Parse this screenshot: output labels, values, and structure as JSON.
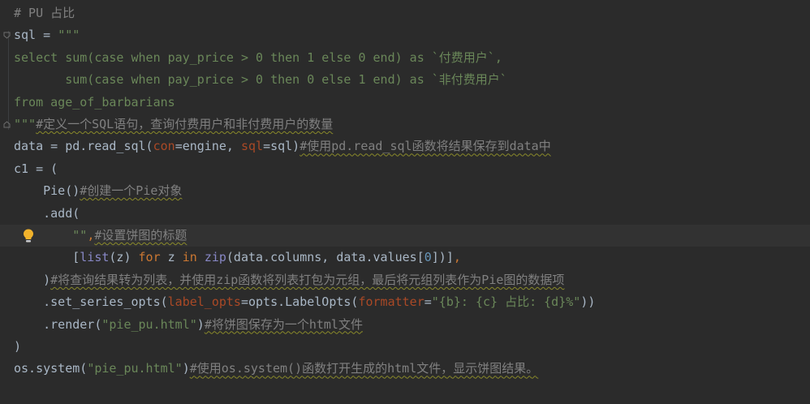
{
  "colors": {
    "background": "#2b2b2b",
    "current_line": "#323232",
    "plain": "#a9b7c6",
    "comment": "#808080",
    "string": "#6a8759",
    "keyword": "#cc7832",
    "builtin": "#8888c6",
    "number": "#6897bb",
    "param": "#aa4926"
  },
  "icons": {
    "fold": "fold-marker-icon",
    "intention": "lightbulb-icon"
  },
  "editor": {
    "lines": [
      {
        "tokens": [
          {
            "c": "t-comment",
            "t": "# PU 占比"
          }
        ]
      },
      {
        "tokens": [
          {
            "c": "t-plain",
            "t": "sql = "
          },
          {
            "c": "t-str",
            "t": "\"\"\""
          }
        ]
      },
      {
        "tokens": [
          {
            "c": "t-str",
            "t": "select sum(case when pay_price > 0 then 1 else 0 end) as `付费用户`,"
          }
        ]
      },
      {
        "tokens": [
          {
            "c": "t-str",
            "t": "       sum(case when pay_price > 0 then 0 else 1 end) as `非付费用户`"
          }
        ]
      },
      {
        "tokens": [
          {
            "c": "t-str",
            "t": "from age_of_barbarians"
          }
        ]
      },
      {
        "tokens": [
          {
            "c": "t-str",
            "t": "\"\"\""
          },
          {
            "c": "t-comment-u",
            "t": "#定义一个SQL语句，查询付费用户和非付费用户的数量"
          }
        ]
      },
      {
        "tokens": [
          {
            "c": "t-plain",
            "t": "data = pd.read_sql("
          },
          {
            "c": "t-param",
            "t": "con"
          },
          {
            "c": "t-plain",
            "t": "=engine, "
          },
          {
            "c": "t-param",
            "t": "sql"
          },
          {
            "c": "t-plain",
            "t": "=sql)"
          },
          {
            "c": "t-comment-u",
            "t": "#使用pd.read_sql函数将结果保存到data中"
          }
        ]
      },
      {
        "tokens": [
          {
            "c": "t-plain",
            "t": "c1 = ("
          }
        ]
      },
      {
        "tokens": [
          {
            "c": "t-plain",
            "t": "    Pie()"
          },
          {
            "c": "t-comment-u",
            "t": "#创建一个Pie对象"
          }
        ]
      },
      {
        "tokens": [
          {
            "c": "t-plain",
            "t": "    .add("
          }
        ]
      },
      {
        "tokens": [
          {
            "c": "t-plain",
            "t": "        "
          },
          {
            "c": "t-str",
            "t": "\"\""
          },
          {
            "c": "t-kw",
            "t": ","
          },
          {
            "c": "t-comment-u",
            "t": "#设置饼图的标题"
          }
        ]
      },
      {
        "tokens": [
          {
            "c": "t-plain",
            "t": "        ["
          },
          {
            "c": "t-builtin",
            "t": "list"
          },
          {
            "c": "t-plain",
            "t": "(z) "
          },
          {
            "c": "t-kw",
            "t": "for"
          },
          {
            "c": "t-plain",
            "t": " z "
          },
          {
            "c": "t-kw",
            "t": "in"
          },
          {
            "c": "t-plain",
            "t": " "
          },
          {
            "c": "t-builtin",
            "t": "zip"
          },
          {
            "c": "t-plain",
            "t": "(data.columns, data.values["
          },
          {
            "c": "t-num",
            "t": "0"
          },
          {
            "c": "t-plain",
            "t": "])]"
          },
          {
            "c": "t-kw",
            "t": ","
          }
        ]
      },
      {
        "tokens": [
          {
            "c": "t-plain",
            "t": "    )"
          },
          {
            "c": "t-comment-u",
            "t": "#将查询结果转为列表，并使用zip函数将列表打包为元组，最后将元组列表作为Pie图的数据项"
          }
        ]
      },
      {
        "tokens": [
          {
            "c": "t-plain",
            "t": "    .set_series_opts("
          },
          {
            "c": "t-param",
            "t": "label_opts"
          },
          {
            "c": "t-plain",
            "t": "=opts.LabelOpts("
          },
          {
            "c": "t-param",
            "t": "formatter"
          },
          {
            "c": "t-plain",
            "t": "="
          },
          {
            "c": "t-str",
            "t": "\"{b}: {c} 占比: {d}%\""
          },
          {
            "c": "t-plain",
            "t": "))"
          }
        ]
      },
      {
        "tokens": [
          {
            "c": "t-plain",
            "t": "    .render("
          },
          {
            "c": "t-str",
            "t": "\"pie_pu.html\""
          },
          {
            "c": "t-plain",
            "t": ")"
          },
          {
            "c": "t-comment-u",
            "t": "#将饼图保存为一个html文件"
          }
        ]
      },
      {
        "tokens": [
          {
            "c": "t-plain",
            "t": ")"
          }
        ]
      },
      {
        "tokens": [
          {
            "c": "t-plain",
            "t": "os.system("
          },
          {
            "c": "t-str",
            "t": "\"pie_pu.html\""
          },
          {
            "c": "t-plain",
            "t": ")"
          },
          {
            "c": "t-comment-u",
            "t": "#使用os.system()函数打开生成的html文件，显示饼图结果。"
          }
        ]
      }
    ]
  }
}
